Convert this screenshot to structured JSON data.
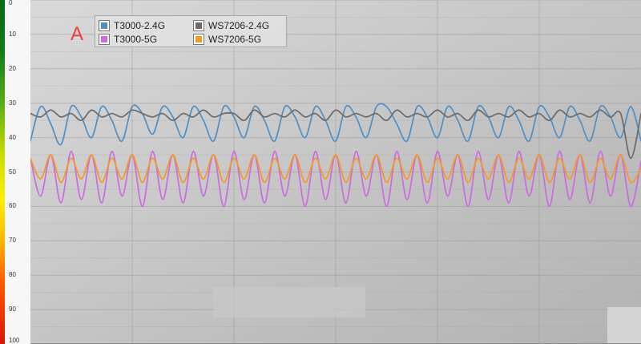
{
  "annotation": {
    "letter": "A"
  },
  "legend": {
    "items": [
      {
        "label": "T3000-2.4G",
        "color": "#4f8fc4"
      },
      {
        "label": "WS7206-2.4G",
        "color": "#6b6b6b"
      },
      {
        "label": "T3000-5G",
        "color": "#cc6ae0"
      },
      {
        "label": "WS7206-5G",
        "color": "#f19a26"
      }
    ]
  },
  "chart_data": {
    "type": "line",
    "title": "",
    "xlabel": "",
    "ylabel": "",
    "ylim": [
      0,
      100
    ],
    "y_ticks": [
      "0",
      "10",
      "20",
      "30",
      "40",
      "50",
      "60",
      "70",
      "80",
      "90",
      "100"
    ],
    "grid": true,
    "legend": "top-left",
    "x": [
      0,
      1,
      2,
      3,
      4,
      5,
      6,
      7,
      8,
      9,
      10,
      11,
      12,
      13,
      14,
      15,
      16,
      17,
      18,
      19,
      20,
      21,
      22,
      23,
      24,
      25,
      26,
      27,
      28,
      29,
      30,
      31,
      32,
      33,
      34,
      35,
      36,
      37,
      38,
      39,
      40,
      41,
      42,
      43,
      44,
      45,
      46,
      47,
      48,
      49,
      50,
      51,
      52,
      53,
      54,
      55,
      56,
      57,
      58,
      59,
      60
    ],
    "series": [
      {
        "name": "T3000-2.4G",
        "color": "#4f8fc4",
        "values": [
          41,
          31,
          36,
          42,
          31,
          34,
          40,
          31,
          35,
          41,
          31,
          33,
          39,
          31,
          34,
          40,
          31,
          35,
          41,
          31,
          34,
          40,
          31,
          35,
          41,
          31,
          34,
          40,
          31,
          35,
          41,
          31,
          34,
          40,
          31,
          31,
          36,
          41,
          31,
          34,
          40,
          31,
          35,
          41,
          31,
          34,
          40,
          31,
          35,
          41,
          31,
          34,
          40,
          31,
          35,
          41,
          31,
          34,
          40,
          31,
          41
        ]
      },
      {
        "name": "WS7206-2.4G",
        "color": "#6b6b6b",
        "values": [
          33,
          34,
          32,
          34,
          33,
          35,
          32,
          34,
          33,
          34,
          32,
          33,
          34,
          33,
          35,
          33,
          34,
          32,
          34,
          33,
          33,
          35,
          32,
          34,
          33,
          34,
          32,
          34,
          33,
          35,
          32,
          34,
          33,
          34,
          33,
          35,
          32,
          34,
          33,
          34,
          32,
          34,
          33,
          35,
          32,
          34,
          33,
          34,
          32,
          34,
          33,
          35,
          32,
          34,
          33,
          34,
          32,
          34,
          33,
          46,
          33
        ]
      },
      {
        "name": "T3000-5G",
        "color": "#cc6ae0",
        "values": [
          46,
          57,
          45,
          59,
          44,
          58,
          45,
          59,
          44,
          57,
          45,
          60,
          44,
          58,
          45,
          59,
          44,
          57,
          45,
          60,
          44,
          58,
          45,
          59,
          44,
          57,
          45,
          60,
          44,
          58,
          45,
          59,
          44,
          57,
          45,
          60,
          44,
          58,
          45,
          59,
          44,
          57,
          45,
          60,
          44,
          58,
          45,
          59,
          44,
          57,
          45,
          60,
          44,
          58,
          45,
          59,
          44,
          57,
          45,
          60,
          47
        ]
      },
      {
        "name": "WS7206-5G",
        "color": "#f19a26",
        "values": [
          46,
          52,
          45,
          53,
          46,
          52,
          45,
          53,
          46,
          52,
          45,
          53,
          46,
          52,
          45,
          53,
          46,
          52,
          45,
          53,
          46,
          52,
          45,
          53,
          46,
          52,
          45,
          53,
          46,
          52,
          45,
          53,
          46,
          52,
          45,
          53,
          46,
          52,
          45,
          53,
          46,
          52,
          45,
          53,
          46,
          52,
          45,
          53,
          46,
          52,
          45,
          53,
          46,
          52,
          45,
          53,
          46,
          52,
          45,
          53,
          49
        ]
      }
    ]
  }
}
